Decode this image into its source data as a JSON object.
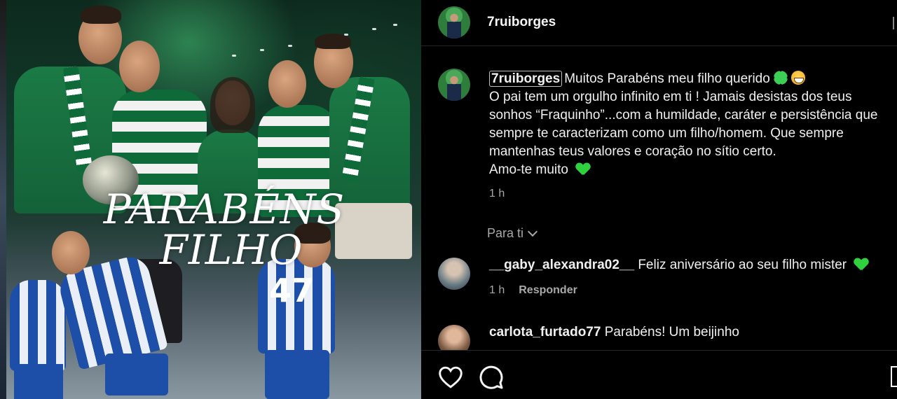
{
  "post": {
    "image": {
      "overlay_line1": "PARABÉNS",
      "overlay_line2": "FILHO",
      "jersey_number": "47"
    }
  },
  "header": {
    "username": "7ruiborges"
  },
  "caption": {
    "username": "7ruiborges",
    "line1": "Muitos Parabéns meu filho querido",
    "line2": "O pai tem um orgulho infinito em ti ! Jamais desistas dos teus",
    "line3": "sonhos “Fraquinho”...com a humildade, caráter e persistência que",
    "line4": "sempre te caracterizam como um filho/homem. Que sempre",
    "line5": "mantenhas teus valores e coração no sítio certo.",
    "line6": "Amo-te muito",
    "time": "1 h"
  },
  "section": {
    "label": "Para ti"
  },
  "comments": [
    {
      "username": "__gaby_alexandra02__",
      "text": "Feliz aniversário ao seu filho mister",
      "time": "1 h",
      "reply_label": "Responder"
    },
    {
      "username": "carlota_furtado77",
      "text": "Parabéns! Um beijinho"
    }
  ],
  "icons": {
    "like": "heart-outline-icon",
    "comment": "comment-bubble-icon",
    "save": "bookmark-icon",
    "emoji_clover": "four-leaf-clover",
    "emoji_grin": "grinning-face",
    "emoji_heart": "green-heart"
  },
  "colors": {
    "background": "#000000",
    "text": "#f5f5f5",
    "muted": "#a8a8a8",
    "emoji_green": "#2fd13e"
  }
}
